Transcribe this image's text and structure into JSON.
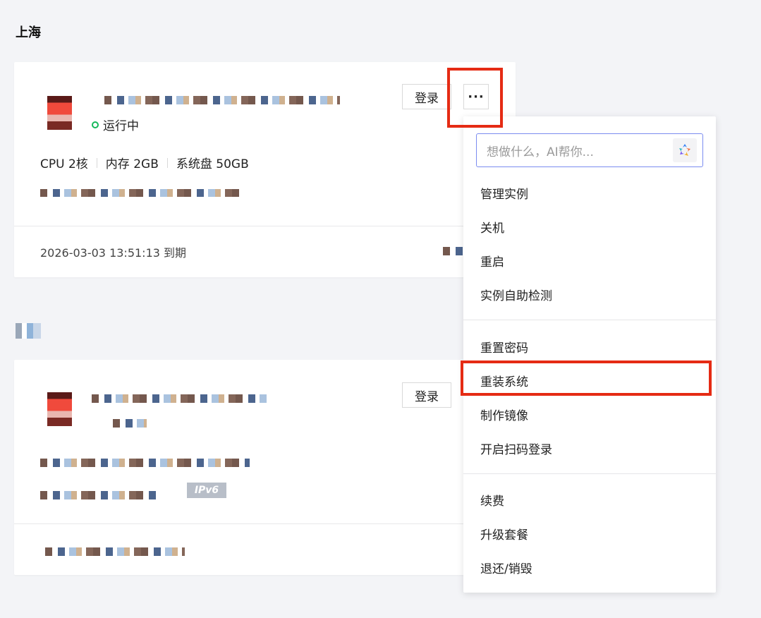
{
  "region": {
    "title": "上海"
  },
  "instances": [
    {
      "status": "运行中",
      "specs": [
        "CPU 2核",
        "内存 2GB",
        "系统盘 50GB"
      ],
      "expire": "2026-03-03 13:51:13 到期",
      "login_label": "登录",
      "more_label": "···"
    },
    {
      "login_label": "登录",
      "ipv6_label": "IPv6"
    }
  ],
  "menu": {
    "search_placeholder": "想做什么，AI帮你...",
    "groups": [
      [
        "管理实例",
        "关机",
        "重启",
        "实例自助检测"
      ],
      [
        "重置密码",
        "重装系统",
        "制作镜像",
        "开启扫码登录"
      ],
      [
        "续费",
        "升级套餐",
        "退还/销毁"
      ]
    ]
  },
  "colors": {
    "highlight": "#e52b14",
    "status_running": "#14b85a",
    "search_border": "#7b8cf0"
  }
}
